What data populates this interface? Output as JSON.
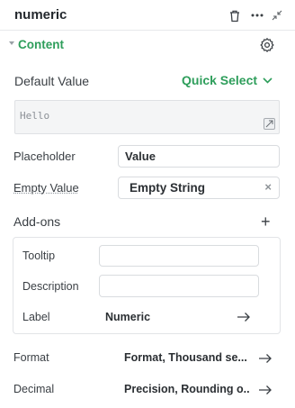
{
  "header": {
    "title": "numeric",
    "delete_icon": "trash-icon",
    "more_icon": "more-horizontal-icon",
    "collapse_icon": "minimize-icon"
  },
  "section": {
    "title": "Content",
    "settings_icon": "gear-icon"
  },
  "default_value": {
    "label": "Default Value",
    "quick_select": "Quick Select",
    "value": "Hello"
  },
  "placeholder": {
    "label": "Placeholder",
    "value": "Value"
  },
  "empty_value": {
    "label": "Empty Value",
    "value": "Empty String",
    "clear": "×"
  },
  "addons": {
    "label": "Add-ons",
    "add": "+",
    "tooltip_label": "Tooltip",
    "tooltip_value": "",
    "description_label": "Description",
    "description_value": "",
    "label_label": "Label",
    "label_value": "Numeric"
  },
  "format": {
    "label": "Format",
    "value": "Format, Thousand se..."
  },
  "decimal": {
    "label": "Decimal",
    "value": "Precision, Rounding o..."
  },
  "colors": {
    "accent": "#2e9e5b",
    "text": "#2b2f33",
    "border": "#d9dcdf"
  }
}
